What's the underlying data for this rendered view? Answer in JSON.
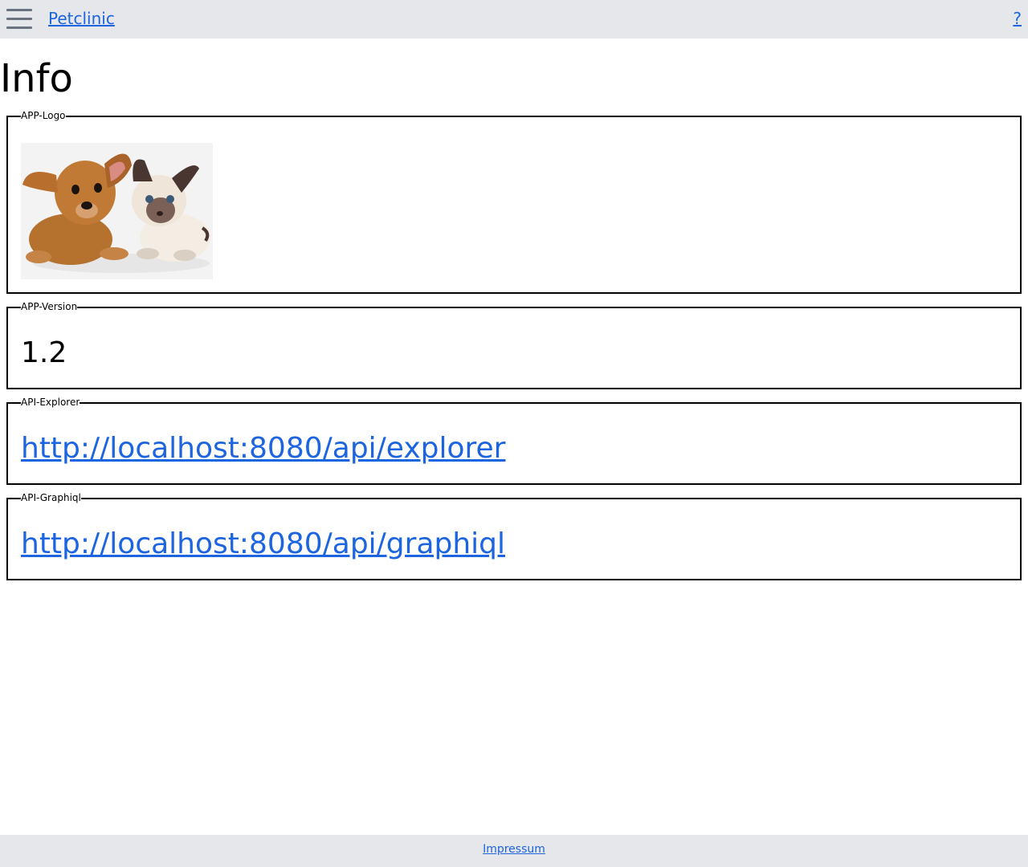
{
  "header": {
    "menu_icon": "hamburger-menu-icon",
    "brand": "Petclinic",
    "help": "?"
  },
  "page": {
    "title": "Info"
  },
  "sections": {
    "logo": {
      "legend": "APP-Logo",
      "image": "puppy-and-kitten"
    },
    "version": {
      "legend": "APP-Version",
      "value": "1.2"
    },
    "explorer": {
      "legend": "API-Explorer",
      "link": "http://localhost:8080/api/explorer"
    },
    "graphiql": {
      "legend": "API-Graphiql",
      "link": "http://localhost:8080/api/graphiql"
    }
  },
  "footer": {
    "impressum": "Impressum"
  },
  "colors": {
    "bar_background": "#e5e7eb",
    "link": "#1d64e0",
    "menu_icon": "#6b7280"
  }
}
